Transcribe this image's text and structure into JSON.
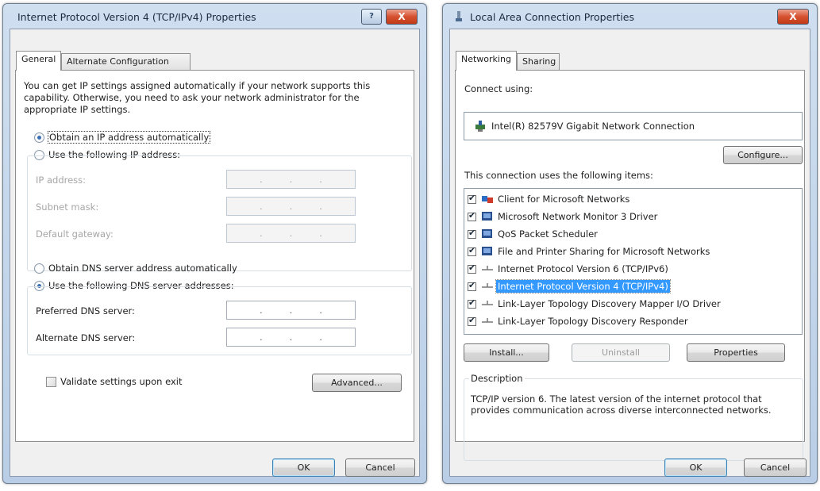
{
  "left_dialog": {
    "title": "Internet Protocol Version 4 (TCP/IPv4) Properties",
    "help_button": "?",
    "close_button": "X",
    "tabs": [
      "General",
      "Alternate Configuration"
    ],
    "intro_text": "You can get IP settings assigned automatically if your network supports this capability. Otherwise, you need to ask your network administrator for the appropriate IP settings.",
    "ip_auto_label": "Obtain an IP address automatically",
    "ip_manual_label": "Use the following IP address:",
    "ip_address_label": "IP address:",
    "subnet_mask_label": "Subnet mask:",
    "default_gateway_label": "Default gateway:",
    "dns_auto_label": "Obtain DNS server address automatically",
    "dns_manual_label": "Use the following DNS server addresses:",
    "preferred_dns_label": "Preferred DNS server:",
    "alternate_dns_label": "Alternate DNS server:",
    "ip_dot": ".",
    "validate_label": "Validate settings upon exit",
    "advanced_button": "Advanced...",
    "ok_button": "OK",
    "cancel_button": "Cancel",
    "selected_ip_option": "automatic",
    "selected_dns_option": "manual",
    "validate_checked": false
  },
  "right_dialog": {
    "title": "Local Area Connection Properties",
    "close_button": "X",
    "tabs": [
      "Networking",
      "Sharing"
    ],
    "connect_using_label": "Connect using:",
    "adapter_name": "Intel(R) 82579V Gigabit Network Connection",
    "configure_button": "Configure...",
    "items_label": "This connection uses the following items:",
    "items": [
      {
        "label": "Client for Microsoft Networks",
        "checked": true,
        "icon": "network-client-icon",
        "selected": false
      },
      {
        "label": "Microsoft Network Monitor 3 Driver",
        "checked": true,
        "icon": "network-service-icon",
        "selected": false
      },
      {
        "label": "QoS Packet Scheduler",
        "checked": true,
        "icon": "network-service-icon",
        "selected": false
      },
      {
        "label": "File and Printer Sharing for Microsoft Networks",
        "checked": true,
        "icon": "network-service-icon",
        "selected": false
      },
      {
        "label": "Internet Protocol Version 6 (TCP/IPv6)",
        "checked": true,
        "icon": "protocol-icon",
        "selected": false
      },
      {
        "label": "Internet Protocol Version 4 (TCP/IPv4)",
        "checked": true,
        "icon": "protocol-icon",
        "selected": true
      },
      {
        "label": "Link-Layer Topology Discovery Mapper I/O Driver",
        "checked": true,
        "icon": "protocol-icon",
        "selected": false
      },
      {
        "label": "Link-Layer Topology Discovery Responder",
        "checked": true,
        "icon": "protocol-icon",
        "selected": false
      }
    ],
    "install_button": "Install...",
    "uninstall_button": "Uninstall",
    "properties_button": "Properties",
    "description_label": "Description",
    "description_text": "TCP/IP version 6. The latest version of the internet protocol that provides communication across diverse interconnected networks.",
    "ok_button": "OK",
    "cancel_button": "Cancel"
  },
  "colors": {
    "selection": "#3399ff",
    "close_button": "#c8452a",
    "title_bar": "#c4d7ed"
  }
}
